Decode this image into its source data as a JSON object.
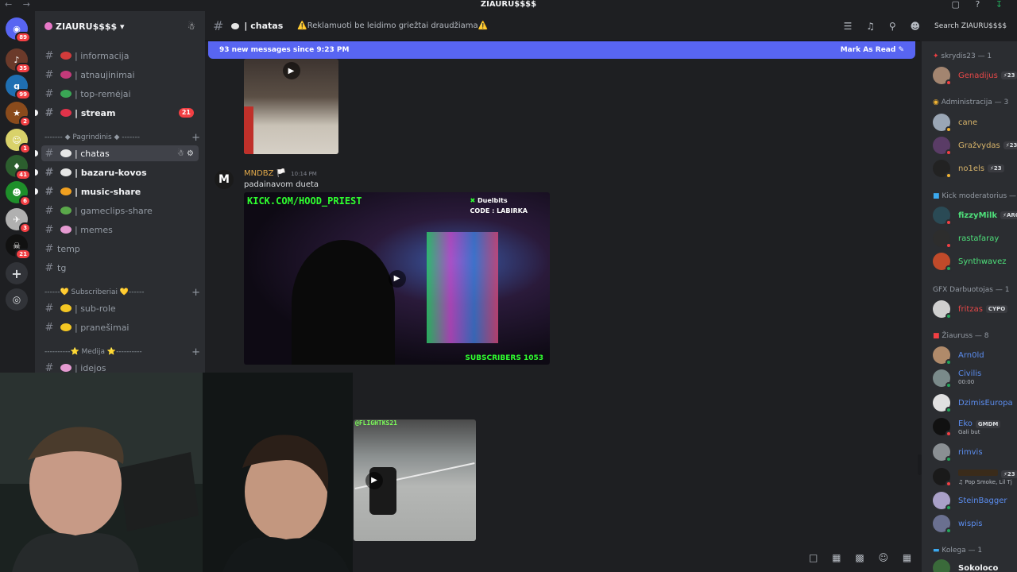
{
  "titlebar": {
    "server_name": "ZIAURU$$$$"
  },
  "server": {
    "name": "ZIAURU$$$$",
    "rail_badges": [
      "89",
      "35",
      "99",
      "2",
      "1",
      "41",
      "6",
      "3",
      "21"
    ]
  },
  "sidebar": {
    "channels_top": [
      {
        "name": "| informacija",
        "bold": false
      },
      {
        "name": "| atnaujinimai",
        "bold": false
      },
      {
        "name": "| top-remėjai",
        "bold": false
      },
      {
        "name": "| stream",
        "bold": true,
        "count": "21"
      }
    ],
    "category_1": "------- ◆ Pagrindinis ◆ -------",
    "channels_mid": [
      {
        "name": "| chatas",
        "active": true
      },
      {
        "name": "| bazaru-kovos",
        "bold": true
      },
      {
        "name": "| music-share",
        "bold": true
      },
      {
        "name": "| gameclips-share",
        "bold": false
      },
      {
        "name": "| memes",
        "bold": false
      },
      {
        "name": "temp",
        "bold": false
      },
      {
        "name": "tg",
        "bold": false
      }
    ],
    "category_2": "------💛 Subscriberiai 💛------",
    "channels_sub": [
      {
        "name": "| sub-role"
      },
      {
        "name": "| pranešimai"
      }
    ],
    "category_3": "----------⭐ Medija ⭐----------",
    "channels_media": [
      {
        "name": "| idejos"
      }
    ]
  },
  "header": {
    "channel": "| chatas",
    "topic": "⚠️Reklamuoti be leidimo griežtai draudžiama⚠️",
    "search_placeholder": "Search ZIAURU$$$$"
  },
  "newbar": {
    "text": "93 new messages since 9:23 PM",
    "action": "Mark As Read"
  },
  "messages": {
    "author": "MNDBZ",
    "badge": "🏳️",
    "time": "10:14 PM",
    "text": "padainavom dueta",
    "video2": {
      "top_text": "KICK.COM/HOOD_PRIEST",
      "brand": "Duelbits",
      "code": "CODE : LABIRKA",
      "subs": "SUBSCRIBERS 1053"
    },
    "video3": {
      "label": "@FLIGHTKS21"
    }
  },
  "members": {
    "groups": [
      {
        "title": "skrydis23 — 1"
      },
      {
        "title": "Administracija — 3"
      },
      {
        "title": "Kick moderatorius —"
      },
      {
        "title": "GFX Darbuotojas — 1"
      },
      {
        "title": "Žiauruss — 8"
      },
      {
        "title": "Kolega — 1"
      }
    ],
    "list": [
      {
        "name": "Genadijus",
        "tag": "⚡23",
        "sub": ""
      },
      {
        "name": "cane",
        "tag": "",
        "sub": ""
      },
      {
        "name": "Gražvydas",
        "tag": "⚡23",
        "sub": ""
      },
      {
        "name": "no1els",
        "tag": "⚡23",
        "sub": ""
      },
      {
        "name": "fizzyMilk",
        "tag": "⚡ARC",
        "sub": ""
      },
      {
        "name": "rastafaray",
        "tag": "",
        "sub": ""
      },
      {
        "name": "Synthwavez",
        "tag": "",
        "sub": ""
      },
      {
        "name": "fritzas",
        "tag": "CYPO",
        "sub": ""
      },
      {
        "name": "Arn0ld",
        "tag": "",
        "sub": ""
      },
      {
        "name": "Civilis",
        "tag": "",
        "sub": "00:00"
      },
      {
        "name": "DzimisEuropa",
        "tag": "",
        "sub": ""
      },
      {
        "name": "Eko",
        "tag": "GMDM",
        "sub": "Gali but"
      },
      {
        "name": "rimvis",
        "tag": "",
        "sub": ""
      },
      {
        "name": "",
        "tag": "⚡23",
        "sub": "♫ Pop Smoke, Lil Tj"
      },
      {
        "name": "SteinBagger",
        "tag": "",
        "sub": ""
      },
      {
        "name": "wispis",
        "tag": "",
        "sub": ""
      },
      {
        "name": "Sokoloco",
        "tag": "",
        "sub": ""
      }
    ]
  },
  "colors": {
    "accent": "#5865f2",
    "online": "#23a55a",
    "dnd": "#f23f43",
    "idle": "#f0b232"
  }
}
